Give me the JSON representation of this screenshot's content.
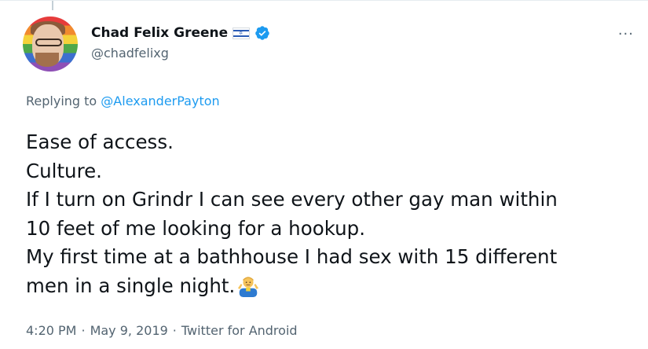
{
  "author": {
    "display_name": "Chad Felix Greene",
    "handle": "@chadfelixg",
    "flag_icon": "israel-flag-icon",
    "verified_icon": "verified-badge-icon",
    "avatar_icon": "profile-avatar"
  },
  "reply": {
    "prefix": "Replying to",
    "target": "@AlexanderPayton"
  },
  "tweet_lines": [
    "Ease of access.",
    "Culture.",
    "If I turn on Grindr I can see every other gay man within",
    "10 feet of me looking for a hookup.",
    "My first time at a bathhouse I had sex with 15 different",
    "men in a single night."
  ],
  "emoji": "man-shrugging-emoji",
  "meta": {
    "time": "4:20 PM",
    "sep1": "·",
    "date": "May 9, 2019",
    "sep2": "·",
    "source": "Twitter for Android"
  },
  "colors": {
    "link": "#1d9bf0",
    "muted": "#536471",
    "text": "#0f1419"
  }
}
